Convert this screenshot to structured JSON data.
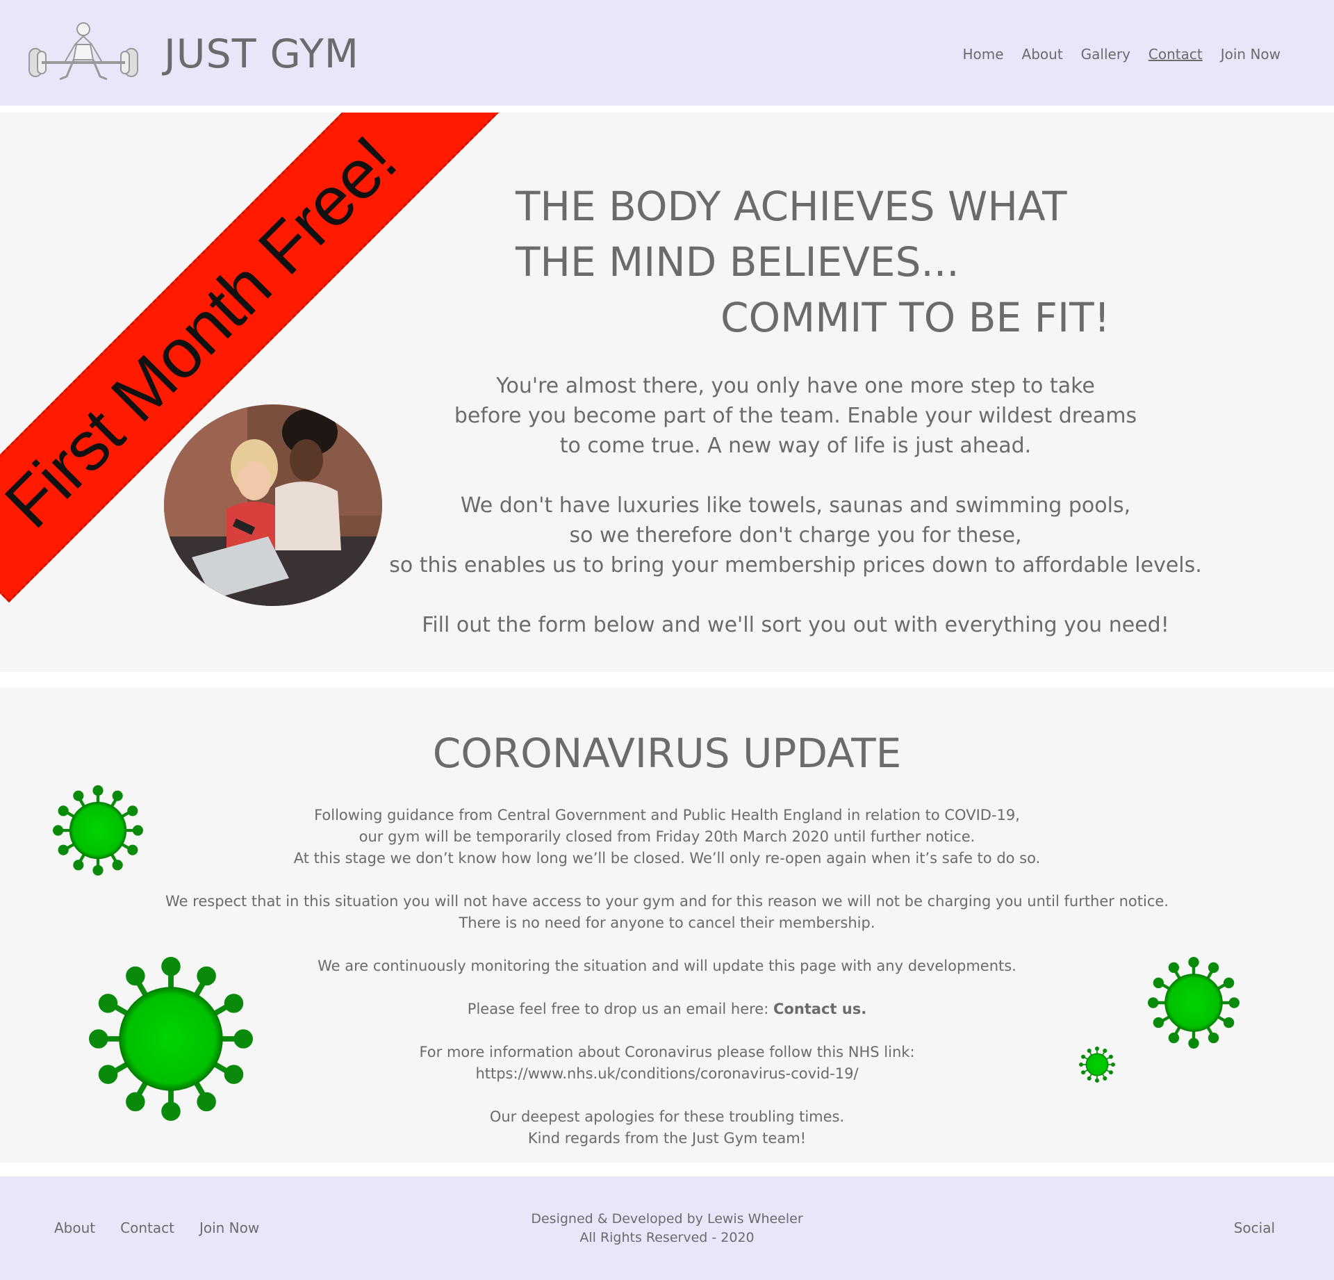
{
  "header": {
    "brand": "JUST GYM",
    "logo_icon": "weightlifter-icon",
    "nav": [
      {
        "label": "Home"
      },
      {
        "label": "About"
      },
      {
        "label": "Gallery"
      },
      {
        "label": "Contact",
        "active": true
      },
      {
        "label": "Join Now"
      }
    ]
  },
  "hero": {
    "banner": "First Month Free!",
    "headline_line1": "THE BODY ACHIEVES WHAT",
    "headline_line2": "THE MIND BELIEVES...",
    "headline_line3": "COMMIT TO BE FIT!",
    "paragraph1": [
      "You're almost there, you only have one more step to take",
      "before you become part of the team. Enable your wildest dreams",
      "to come true. A new way of life is just ahead."
    ],
    "paragraph2": [
      "We don't have luxuries like towels, saunas and swimming pools,",
      "so we therefore don't charge you for these,",
      "so this enables us to bring your membership prices down to affordable levels."
    ],
    "paragraph3": "Fill out the form below and we'll sort you out with everything you need!"
  },
  "corona": {
    "title": "CORONAVIRUS UPDATE",
    "p1": [
      "Following guidance from Central Government and Public Health England in relation to COVID-19,",
      "our gym will be temporarily closed from Friday 20th March 2020 until further notice.",
      "At this stage we don’t know how long we’ll be closed. We’ll only re-open again when it’s safe to do so."
    ],
    "p2": [
      "We respect that in this situation you will not have access to your gym and for this reason we will not be charging you until further notice.",
      "There is no need for anyone to cancel their membership."
    ],
    "p3": "We are continuously monitoring the situation and will update this page with any developments.",
    "p4_prefix": "Please feel free to drop us an email here: ",
    "p4_link": "Contact us.",
    "p5": [
      "For more information about Coronavirus please follow this NHS link:",
      "https://www.nhs.uk/conditions/coronavirus-covid-19/"
    ],
    "p6": [
      "Our deepest apologies for these troubling times.",
      "Kind regards from the Just Gym team!"
    ],
    "virus_icon": "virus-icon",
    "virus_color": "#00c800"
  },
  "footer": {
    "links": [
      {
        "label": "About"
      },
      {
        "label": "Contact"
      },
      {
        "label": "Join Now"
      }
    ],
    "credit_line1": "Designed & Developed by Lewis Wheeler",
    "credit_line2": "All Rights Reserved - 2020",
    "social": "Social"
  }
}
